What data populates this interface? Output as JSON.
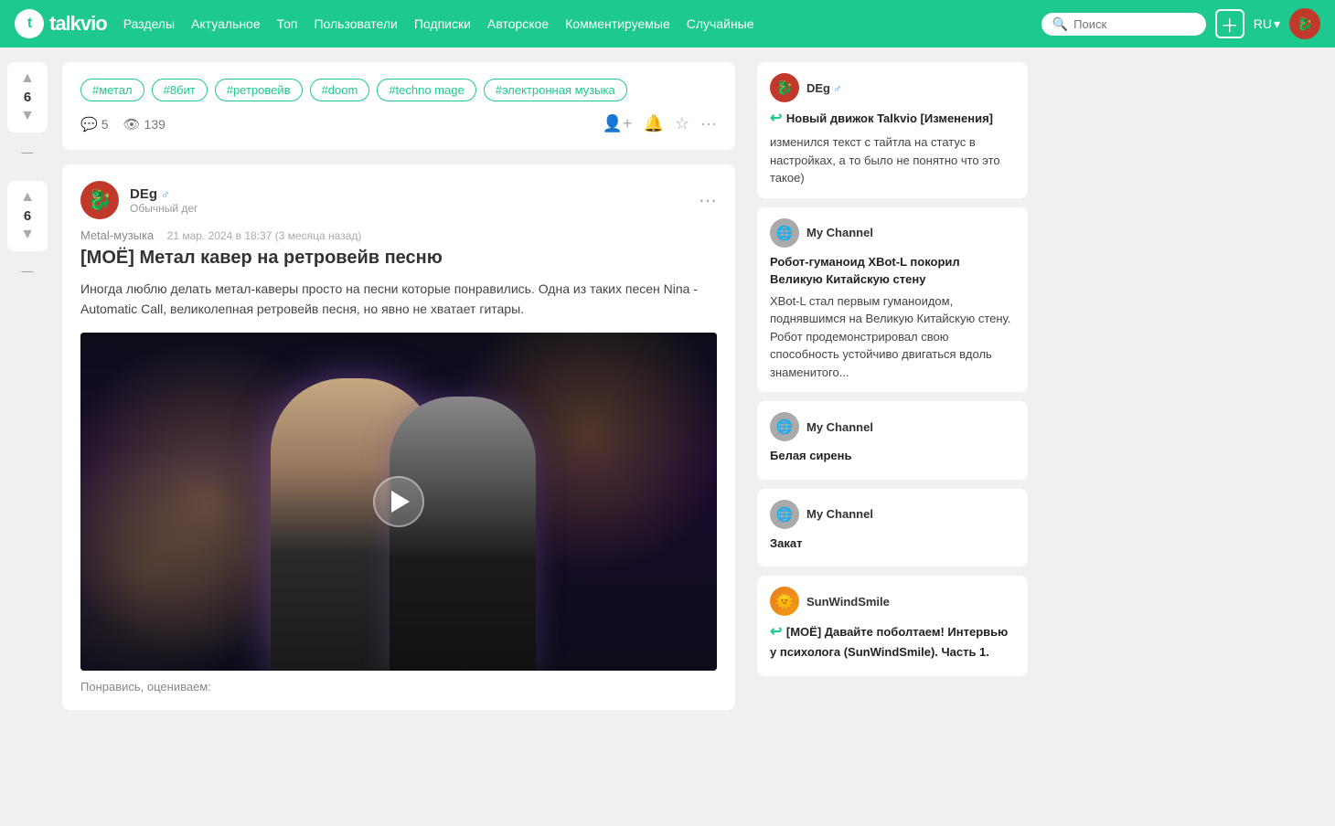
{
  "header": {
    "logo_text": "talkvio",
    "nav": [
      {
        "label": "Разделы",
        "href": "#"
      },
      {
        "label": "Актуальное",
        "href": "#"
      },
      {
        "label": "Топ",
        "href": "#"
      },
      {
        "label": "Пользователи",
        "href": "#"
      },
      {
        "label": "Подписки",
        "href": "#"
      },
      {
        "label": "Авторское",
        "href": "#"
      },
      {
        "label": "Комментируемые",
        "href": "#"
      },
      {
        "label": "Случайные",
        "href": "#"
      }
    ],
    "search_placeholder": "Поиск",
    "lang": "RU"
  },
  "left_votes": [
    {
      "count": "6"
    },
    {
      "count": "6"
    }
  ],
  "tags_section": {
    "tags": [
      "#метал",
      "#8бит",
      "#ретровейв",
      "#doom",
      "#techno mage",
      "#электронная музыка"
    ]
  },
  "post_meta": {
    "comments": "5",
    "views": "139"
  },
  "article": {
    "author_name": "DEg",
    "author_sub": "Обычный дег",
    "channel": "Metal-музыка",
    "date": "21 мар. 2024 в 18:37 (3 месяца назад)",
    "title": "[МОЁ] Метал кавер на ретровейв песню",
    "body": "Иногда люблю делать метал-каверы просто на песни которые понравились. Одна из таких песен Nina - Automatic Call, великолепная ретровейв песня, но явно не хватает гитары.",
    "footer_text": "Понравись, оцениваем:"
  },
  "right_sidebar": {
    "posts": [
      {
        "author": "DEg",
        "gender_icon": "♂",
        "is_arrow": true,
        "arrow_type": "back",
        "title": "Новый движок Talkvio [Изменения]",
        "body": "изменился текст с тайтла на статус в настройках, а то было не понятно что это такое)",
        "avatar_type": "red"
      },
      {
        "author": "My Channel",
        "title": "Робот-гуманоид XBot-L покорил Великую Китайскую стену",
        "body": "XBot-L стал первым гуманоидом, поднявшимся на Великую Китайскую стену. Робот продемонстрировал свою способность устойчиво двигаться вдоль знаменитого...",
        "avatar_type": "gray"
      },
      {
        "author": "My Channel",
        "title": "Белая сирень",
        "body": "",
        "avatar_type": "gray"
      },
      {
        "author": "My Channel",
        "title": "Закат",
        "body": "",
        "avatar_type": "gray"
      },
      {
        "author": "SunWindSmile",
        "is_arrow": true,
        "arrow_type": "back",
        "title": "[МОЁ] Давайте поболтаем! Интервью у психолога (SunWindSmile). Часть 1.",
        "body": "",
        "avatar_type": "sun"
      }
    ]
  }
}
